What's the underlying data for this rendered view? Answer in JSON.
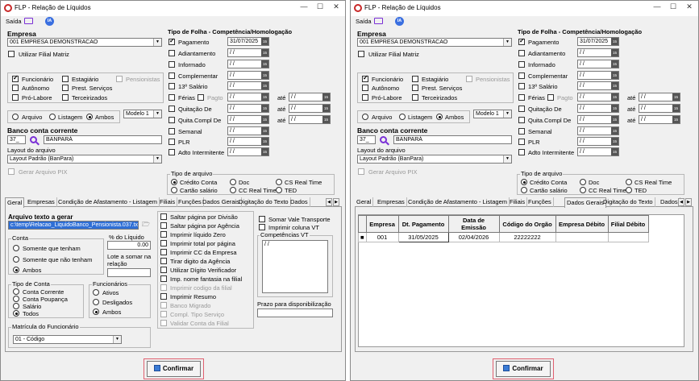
{
  "title": "FLP - Relação de Líquidos",
  "window_controls": {
    "minimize": "—",
    "maximize": "☐",
    "close": "✕"
  },
  "menu": {
    "saida": "Saída",
    "ia": "IA"
  },
  "empresa": {
    "label": "Empresa",
    "value": "001 EMPRESA DEMONSTRACAO",
    "filial_matriz": "Utilizar Filial Matriz"
  },
  "categorias": {
    "funcionario": "Funcionário",
    "estagiario": "Estagiário",
    "pensionistas": "Pensionistas",
    "autonomo": "Autônomo",
    "prest_servicos": "Prest. Serviços",
    "pro_labore": "Pró-Labore",
    "terceirizados": "Terceirizados"
  },
  "saida_opcoes": {
    "arquivo": "Arquivo",
    "listagem": "Listagem",
    "ambos": "Ambos",
    "modelo": "Modelo 1"
  },
  "banco": {
    "label": "Banco conta corrente",
    "codigo": "37_",
    "nome": "BANPARÁ",
    "layout_label": "Layout do arquivo",
    "layout_value": "Layout Padrão (BanPara)",
    "gerar_pix": "Gerar Arquivo PIX"
  },
  "tipo_folha": {
    "header": "Tipo de Folha  -  Competência/Homologação",
    "ate": "até",
    "pagto": "Pagto",
    "empty_date": "/  /",
    "items": [
      {
        "label": "Pagamento",
        "date": "31/07/2025"
      },
      {
        "label": "Adiantamento",
        "date": "/  /"
      },
      {
        "label": "Informado",
        "date": "/  /"
      },
      {
        "label": "Complementar",
        "date": "/  /"
      },
      {
        "label": "13º Salário",
        "date": "/  /"
      },
      {
        "label": "Férias",
        "date": "/  /"
      },
      {
        "label": "Quitação De",
        "date": "/  /"
      },
      {
        "label": "Quita.Compl De",
        "date": "/  /"
      },
      {
        "label": "Semanal",
        "date": "/  /"
      },
      {
        "label": "PLR",
        "date": "/  /"
      },
      {
        "label": "Adto Intermitente",
        "date": "/  /"
      }
    ]
  },
  "tipo_arquivo": {
    "label": "Tipo de arquivo",
    "credito": "Crédito Conta",
    "doc": "Doc",
    "cs_rt": "CS Real Time",
    "cartao": "Cartão salário",
    "cc_rt": "CC Real Time",
    "ted": "TED"
  },
  "tabs": [
    "Geral",
    "Empresas",
    "Condição de Afastamento - Listagem",
    "Filiais",
    "Funções",
    "Dados Gerais",
    "Digitação do Texto",
    "Dados"
  ],
  "geral": {
    "arquivo_label": "Arquivo texto a gerar",
    "arquivo_value": "c:\\temp\\Relacao_LiquidoBanco_Pensionista.037.txt",
    "conta_label": "Conta",
    "conta_opts": [
      "Somente que tenham",
      "Somente que não tenham",
      "Ambos"
    ],
    "pct_label": "% do Líquido",
    "pct_value": "0.00",
    "lote_label": "Lote a somar na relação",
    "tipo_conta_label": "Tipo de Conta",
    "tipo_conta_opts": [
      "Conta Corrente",
      "Conta Poupança",
      "Salário",
      "Todos"
    ],
    "func_label": "Funcionários",
    "func_opts": [
      "Ativos",
      "Desligados",
      "Ambos"
    ],
    "matricula_label": "Matrícula do Funcionário",
    "matricula_value": "01 - Código",
    "checks": [
      "Saltar página por Divisão",
      "Saltar página por Agência",
      "Imprimir líquido Zero",
      "Imprimir total por página",
      "Imprimir CC da Empresa",
      "Tirar digito da Agência",
      "Utilizar Dígito Verificador",
      "Imp. nome fantasia na filial",
      "Imprimir codigo da filial",
      "Imprimir Resumo",
      "Banco Migrado",
      "Compl. Tipo Serviço",
      "Validar Conta da Filial"
    ],
    "somar_vale": "Somar Vale Transporte",
    "imprimir_vt": "Imprimir coluna VT",
    "competencias_vt": "Competências VT",
    "comp_vt_value": "/  /",
    "prazo_label": "Prazo para disponibilização"
  },
  "dados_gerais": {
    "headers": [
      "Empresa",
      "Dt. Pagamento",
      "Data de Emissão",
      "Código do Orgão",
      "Empresa Débito",
      "Filial Débito"
    ],
    "rows": [
      [
        "001",
        "31/05/2025",
        "02/04/2026",
        "22222222",
        "",
        ""
      ]
    ]
  },
  "confirmar": "Confirmar"
}
